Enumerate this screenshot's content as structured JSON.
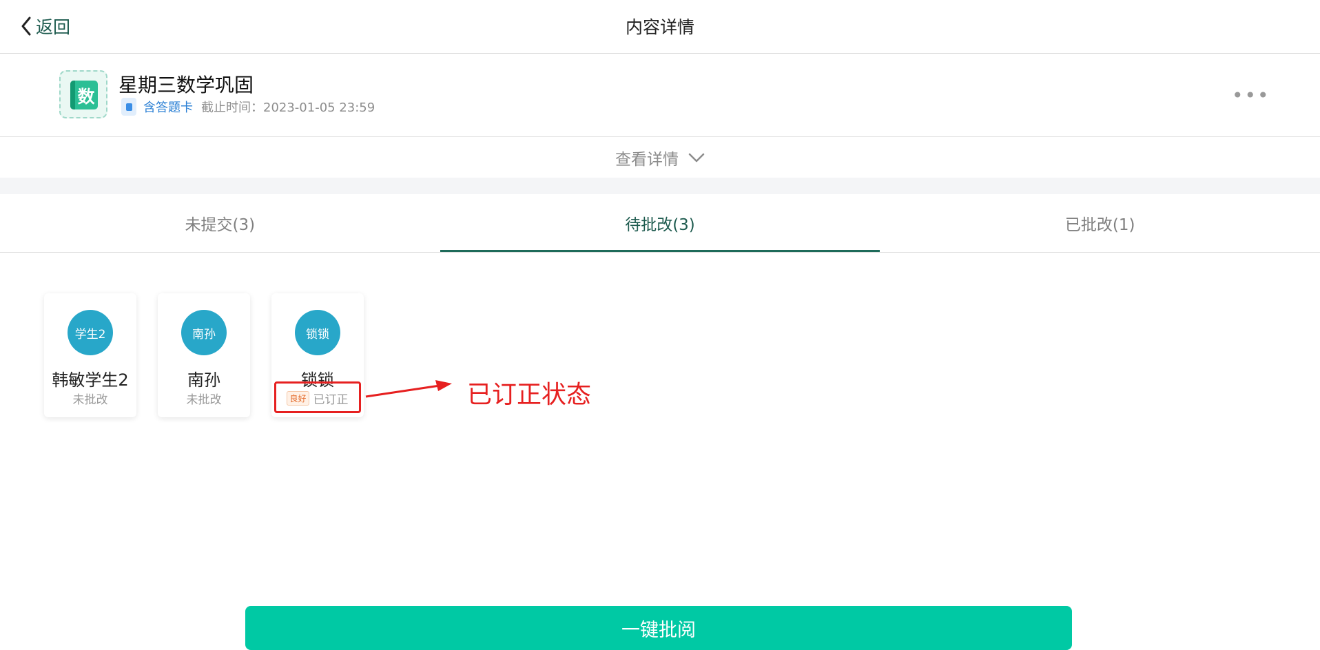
{
  "header": {
    "back_label": "返回",
    "title": "内容详情"
  },
  "homework": {
    "subject_char": "数",
    "title": "星期三数学巩固",
    "answer_card": "含答题卡",
    "deadline": "截止时间：2023-01-05 23:59"
  },
  "view_details": "查看详情",
  "tabs": [
    {
      "label": "未提交(3)",
      "active": false
    },
    {
      "label": "待批改(3)",
      "active": true
    },
    {
      "label": "已批改(1)",
      "active": false
    }
  ],
  "students": [
    {
      "avatar": "学生2",
      "name": "韩敏学生2",
      "status": "未批改"
    },
    {
      "avatar": "南孙",
      "name": "南孙",
      "status": "未批改"
    },
    {
      "avatar": "锁锁",
      "name": "锁锁",
      "grade": "良好",
      "status": "已订正"
    }
  ],
  "annotation": {
    "text": "已订正状态",
    "color": "#e62020"
  },
  "bottom_button": "一键批阅",
  "colors": {
    "accent": "#00c9a4",
    "avatar": "#28a7c9",
    "brand_dark": "#1e5b4f"
  }
}
